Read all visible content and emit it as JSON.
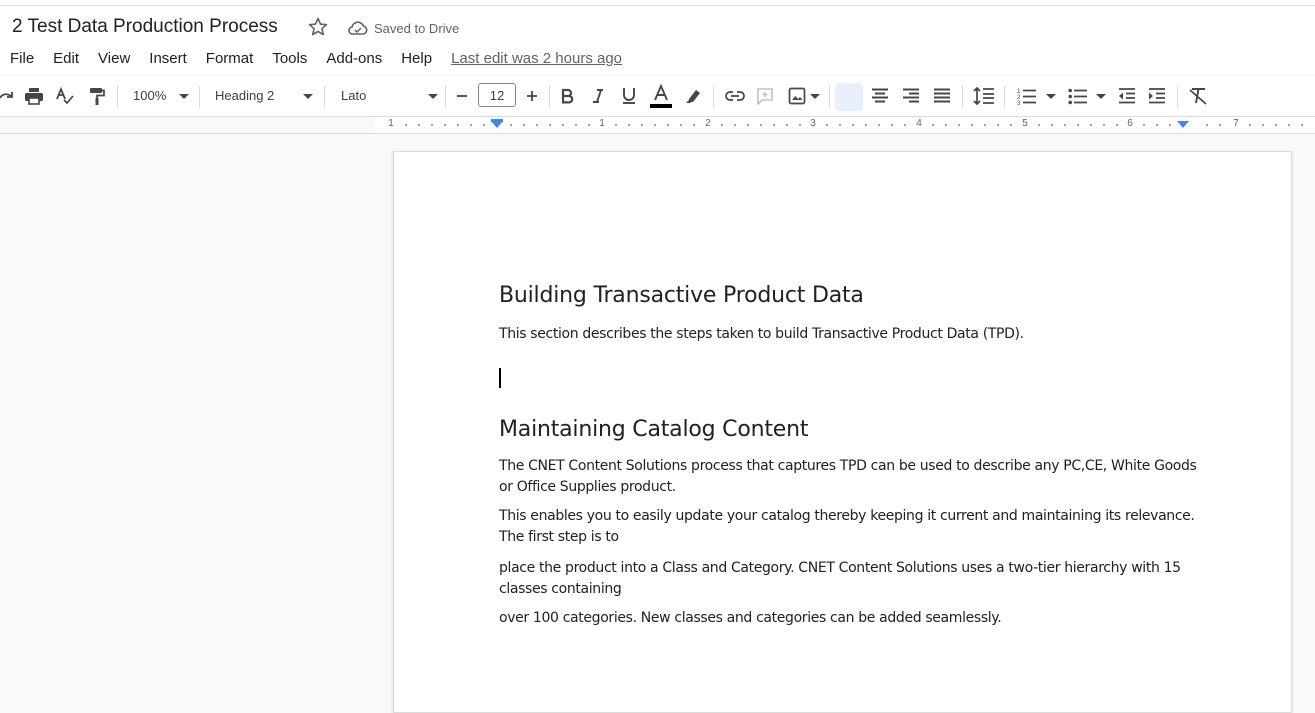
{
  "header": {
    "title": "2 Test Data Production Process",
    "saved_status": "Saved to Drive",
    "last_edit": "Last edit was 2 hours ago"
  },
  "menu": [
    "File",
    "Edit",
    "View",
    "Insert",
    "Format",
    "Tools",
    "Add-ons",
    "Help"
  ],
  "toolbar": {
    "zoom": "100%",
    "style": "Heading 2",
    "font": "Lato",
    "font_size": "12",
    "text_color": "#000000",
    "active_alignment": "left",
    "accent_color": "#1a73e8"
  },
  "ruler": {
    "labels": [
      "1",
      "1",
      "2",
      "3",
      "4",
      "5",
      "6",
      "7"
    ]
  },
  "document": {
    "heading1": "Building Transactive Product Data",
    "para1": "This section describes the steps taken to build Transactive Product Data (TPD).",
    "heading2": "Maintaining Catalog Content",
    "para2": "The CNET Content Solutions process that captures TPD can be used to describe any PC,CE, White Goods or Office Supplies product.",
    "para3": "This enables you to easily update your catalog thereby keeping it current and maintaining its relevance. The first step is to",
    "para4": "place the product into a Class and Category. CNET Content Solutions uses a two-tier hierarchy with 15 classes containing",
    "para5": "over 100 categories. New classes and categories can be added seamlessly."
  }
}
